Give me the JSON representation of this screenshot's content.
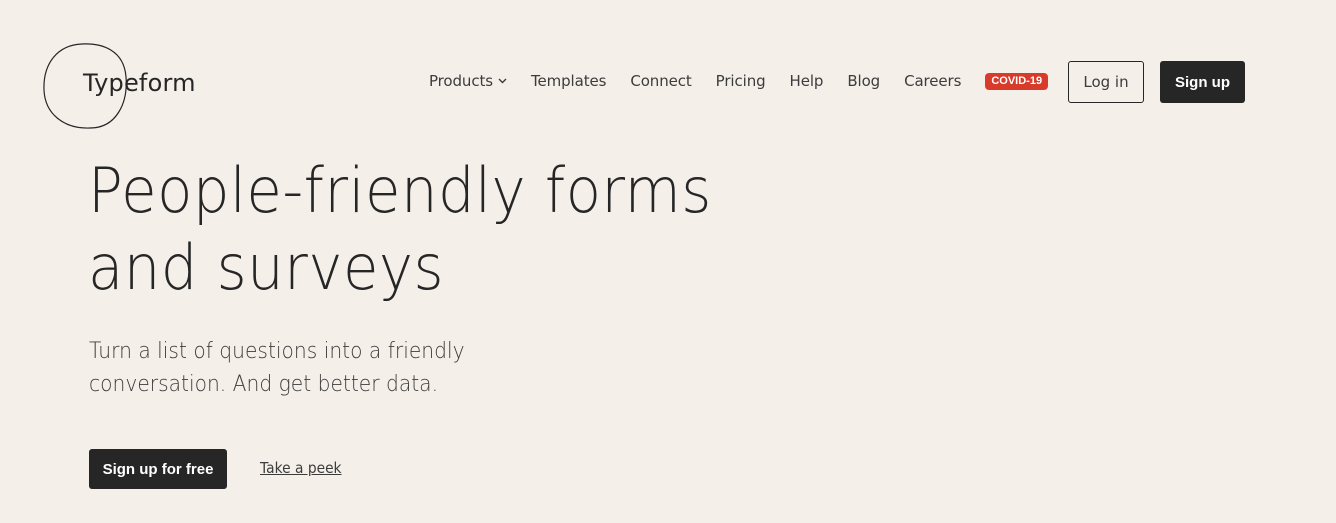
{
  "header": {
    "logo_text": "Typeform",
    "nav": [
      {
        "label": "Products",
        "has_dropdown": true,
        "icon": "chevron-down-icon"
      },
      {
        "label": "Templates"
      },
      {
        "label": "Connect"
      },
      {
        "label": "Pricing"
      },
      {
        "label": "Help"
      },
      {
        "label": "Blog"
      },
      {
        "label": "Careers"
      }
    ],
    "badge": {
      "label": "COVID-19",
      "color": "#d83b2a"
    },
    "login_label": "Log in",
    "signup_label": "Sign up"
  },
  "hero": {
    "title_line1": "People-friendly forms",
    "title_line2": "and surveys",
    "subtitle_line1": "Turn a list of questions into a friendly",
    "subtitle_line2": "conversation. And get better data.",
    "cta_primary": "Sign up for free",
    "cta_secondary": "Take a peek"
  },
  "colors": {
    "background": "#f4efe9",
    "text": "#262627",
    "button_dark": "#262627",
    "badge_red": "#d83b2a"
  }
}
